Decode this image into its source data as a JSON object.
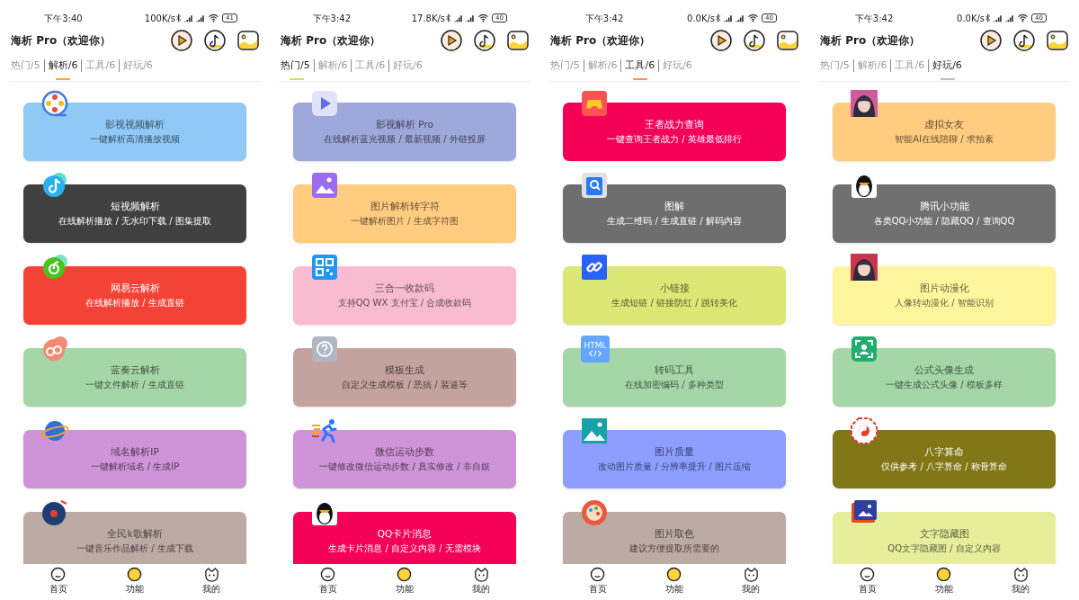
{
  "screens": [
    {
      "status_bar": {
        "time": "下午3:40",
        "speed": "100K/s",
        "battery": "41"
      },
      "title": "海析 Pro（欢迎你）",
      "tabs": [
        {
          "label": "热门/5",
          "selected": false
        },
        {
          "label": "解析/6",
          "selected": true,
          "color": "#f5a623"
        },
        {
          "label": "工具/6",
          "selected": false
        },
        {
          "label": "好玩/6",
          "selected": false
        }
      ],
      "cards": [
        {
          "title": "影视视频解析",
          "subtitle": "一键解析高清播放视频",
          "color": "#90c8f6"
        },
        {
          "title": "短视频解析",
          "subtitle": "在线解析播放 / 无水印下载 / 图集提取",
          "color": "#404040"
        },
        {
          "title": "网易云解析",
          "subtitle": "在线解析播放 / 生成直链",
          "color": "#f44336"
        },
        {
          "title": "蓝奏云解析",
          "subtitle": "一键文件解析 / 生成直链",
          "color": "#a5d6a7"
        },
        {
          "title": "域名解析IP",
          "subtitle": "一键解析域名 / 生成IP",
          "color": "#ce93d8"
        },
        {
          "title": "全民k歌解析",
          "subtitle": "一键音乐作品解析 / 生成下载",
          "color": "#bcaaa4"
        }
      ],
      "nav": [
        {
          "label": "首页",
          "selected": false
        },
        {
          "label": "功能",
          "selected": true
        },
        {
          "label": "我的",
          "selected": false
        }
      ]
    },
    {
      "status_bar": {
        "time": "下午3:42",
        "speed": "17.8K/s",
        "battery": "40"
      },
      "title": "海析 Pro（欢迎你）",
      "tabs": [
        {
          "label": "热门/5",
          "selected": true,
          "color": "#d4e157"
        },
        {
          "label": "解析/6",
          "selected": false
        },
        {
          "label": "工具/6",
          "selected": false
        },
        {
          "label": "好玩/6",
          "selected": false
        }
      ],
      "cards": [
        {
          "title": "影视解析 Pro",
          "subtitle": "在线解析蓝光视频 / 最新视频 / 外链投屏",
          "color": "#9fa8da"
        },
        {
          "title": "图片解析转字符",
          "subtitle": "一键解析图片 / 生成字符图",
          "color": "#ffcc80"
        },
        {
          "title": "三合一收款码",
          "subtitle": "支持QQ WX 支付宝 / 合成收款码",
          "color": "#f8bbd0"
        },
        {
          "title": "模板生成",
          "subtitle": "自定义生成模板 / 恶搞 / 装逼等",
          "color": "#c4a39f"
        },
        {
          "title": "微信运动步数",
          "subtitle": "一键修改微信运动步数 / 真实修改 / 非自娱",
          "color": "#ce93d8"
        },
        {
          "title": "QQ卡片消息",
          "subtitle": "生成卡片消息 / 自定义内容 / 无需模块",
          "color": "#f50057"
        }
      ],
      "nav": [
        {
          "label": "首页",
          "selected": false
        },
        {
          "label": "功能",
          "selected": true
        },
        {
          "label": "我的",
          "selected": false
        }
      ]
    },
    {
      "status_bar": {
        "time": "下午3:42",
        "speed": "0.0K/s",
        "battery": "40"
      },
      "title": "海析 Pro（欢迎你）",
      "tabs": [
        {
          "label": "热门/5",
          "selected": false
        },
        {
          "label": "解析/6",
          "selected": false
        },
        {
          "label": "工具/6",
          "selected": true,
          "color": "#ff8a65"
        },
        {
          "label": "好玩/6",
          "selected": false
        }
      ],
      "cards": [
        {
          "title": "王者战力查询",
          "subtitle": "一键查询王者战力 / 英雄最低排行",
          "color": "#f50057"
        },
        {
          "title": "图解",
          "subtitle": "生成二维码 / 生成直链 / 解码内容",
          "color": "#6e6e6e"
        },
        {
          "title": "小链接",
          "subtitle": "生成短链 / 链接防红 / 跳转美化",
          "color": "#dce775"
        },
        {
          "title": "转码工具",
          "subtitle": "在线加密编码 / 多种类型",
          "color": "#a5d6a7",
          "icon_text": "HTML"
        },
        {
          "title": "图片质量",
          "subtitle": "改动图片质量 / 分辨率提升 / 图片压缩",
          "color": "#8c9eff"
        },
        {
          "title": "图片取色",
          "subtitle": "建议方便提取所需要的",
          "color": "#bcaaa4"
        }
      ],
      "nav": [
        {
          "label": "首页",
          "selected": false
        },
        {
          "label": "功能",
          "selected": true
        },
        {
          "label": "我的",
          "selected": false
        }
      ]
    },
    {
      "status_bar": {
        "time": "下午3:42",
        "speed": "0.0K/s",
        "battery": "40"
      },
      "title": "海析 Pro（欢迎你）",
      "tabs": [
        {
          "label": "热门/5",
          "selected": false
        },
        {
          "label": "解析/6",
          "selected": false
        },
        {
          "label": "工具/6",
          "selected": false
        },
        {
          "label": "好玩/6",
          "selected": true,
          "color": "#bdbdbd"
        }
      ],
      "cards": [
        {
          "title": "虚拟女友",
          "subtitle": "智能AI在线陪聊 / 求拍素",
          "color": "#ffcc80"
        },
        {
          "title": "腾讯小功能",
          "subtitle": "各类QQ小功能 / 隐藏QQ / 查询QQ",
          "color": "#707070"
        },
        {
          "title": "图片动漫化",
          "subtitle": "人像转动漫化 / 智能识别",
          "color": "#fff59d"
        },
        {
          "title": "公式头像生成",
          "subtitle": "一键生成公式头像 / 模板多样",
          "color": "#a5d6a7"
        },
        {
          "title": "八字算命",
          "subtitle": "仅供参考 / 八字算命 / 称骨算命",
          "color": "#827717"
        },
        {
          "title": "文字隐藏图",
          "subtitle": "QQ文字隐藏图 / 自定义内容",
          "color": "#e6ee9c"
        }
      ],
      "nav": [
        {
          "label": "首页",
          "selected": false
        },
        {
          "label": "功能",
          "selected": true
        },
        {
          "label": "我的",
          "selected": false
        }
      ]
    }
  ]
}
